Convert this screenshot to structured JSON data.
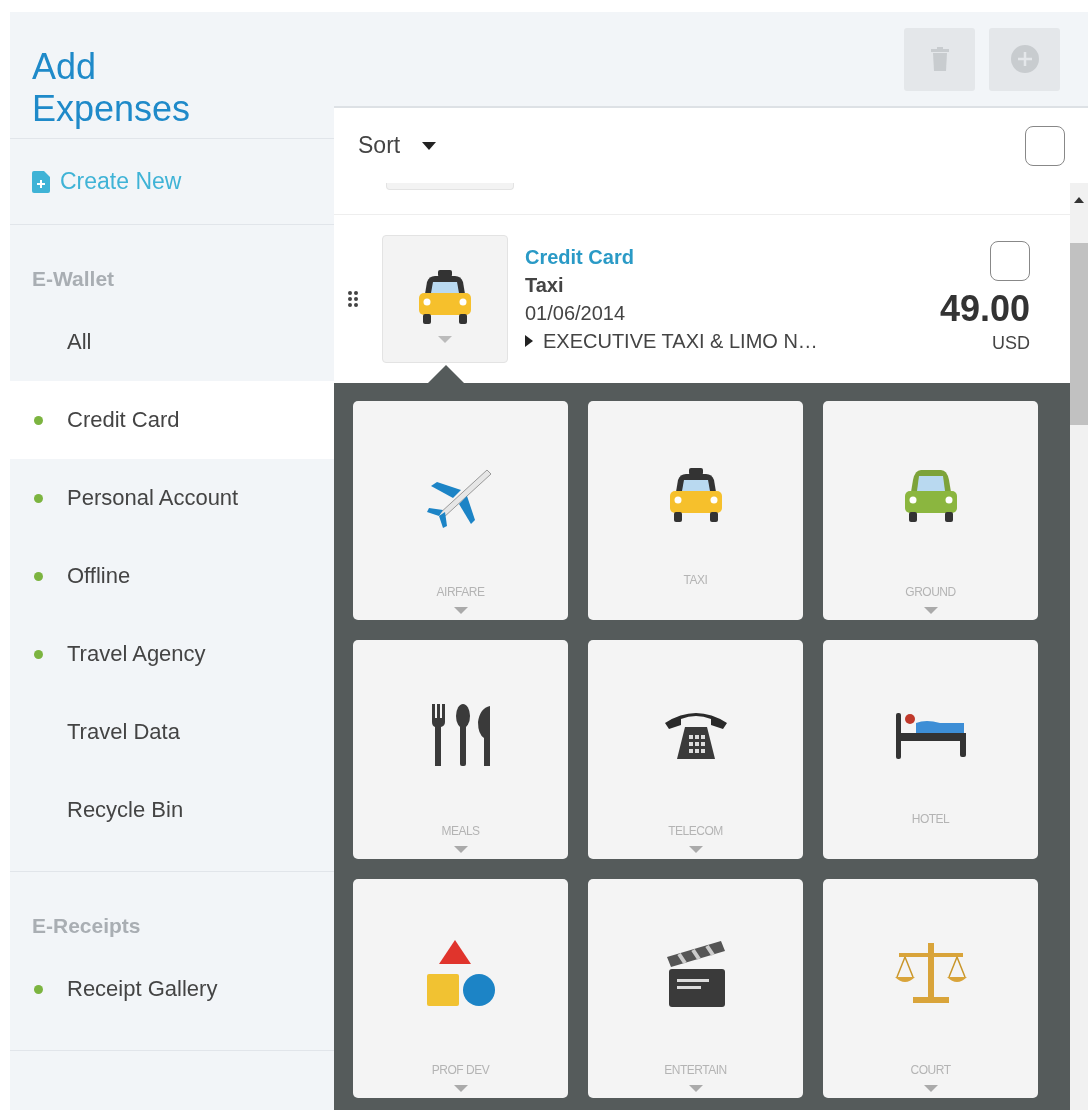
{
  "sidebar": {
    "title": "Add Expenses",
    "create_new": "Create New",
    "sections": [
      {
        "heading": "E-Wallet",
        "items": [
          {
            "label": "All",
            "dot": false,
            "selected": false
          },
          {
            "label": "Credit Card",
            "dot": true,
            "selected": true
          },
          {
            "label": "Personal Account",
            "dot": true,
            "selected": false
          },
          {
            "label": "Offline",
            "dot": true,
            "selected": false
          },
          {
            "label": "Travel Agency",
            "dot": true,
            "selected": false
          },
          {
            "label": "Travel Data",
            "dot": false,
            "selected": false
          },
          {
            "label": "Recycle Bin",
            "dot": false,
            "selected": false
          }
        ]
      },
      {
        "heading": "E-Receipts",
        "items": [
          {
            "label": "Receipt Gallery",
            "dot": true,
            "selected": false
          }
        ]
      }
    ]
  },
  "toolbar": {
    "buttons": [
      {
        "disabled": true
      },
      {
        "disabled": true
      }
    ]
  },
  "sort": {
    "label": "Sort",
    "checked": false
  },
  "expense": {
    "category": "Credit Card",
    "type": "Taxi",
    "date": "01/06/2014",
    "merchant": "EXECUTIVE TAXI & LIMO N…",
    "amount": "49.00",
    "currency": "USD",
    "checked": false,
    "expanded": true
  },
  "expense_types": [
    {
      "label": "AIRFARE",
      "expandable": true
    },
    {
      "label": "TAXI",
      "expandable": false
    },
    {
      "label": "GROUND",
      "expandable": true
    },
    {
      "label": "MEALS",
      "expandable": true
    },
    {
      "label": "TELECOM",
      "expandable": true
    },
    {
      "label": "HOTEL",
      "expandable": false
    },
    {
      "label": "PROF DEV",
      "expandable": true
    },
    {
      "label": "ENTERTAIN",
      "expandable": true
    },
    {
      "label": "COURT",
      "expandable": true
    }
  ]
}
